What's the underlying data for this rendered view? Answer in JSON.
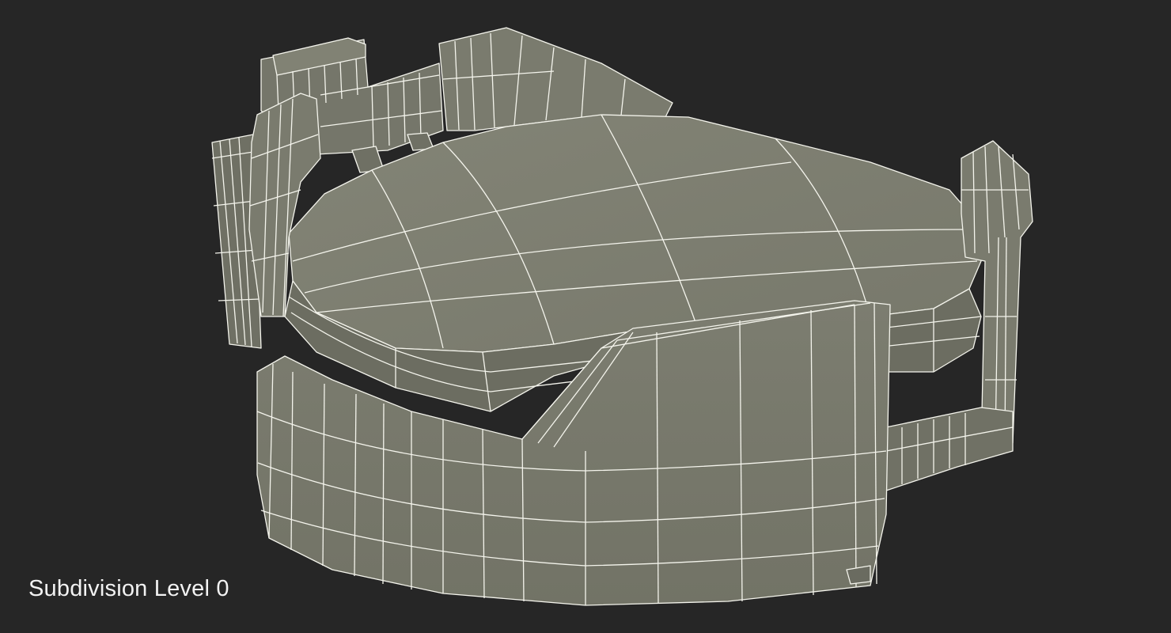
{
  "caption": {
    "text": "Subdivision Level 0"
  },
  "scene": {
    "background_color": "#262626",
    "surface_color": "#7d7e70",
    "surface_shadow_color": "#5f6056",
    "wire_color": "#f4f4ec"
  }
}
